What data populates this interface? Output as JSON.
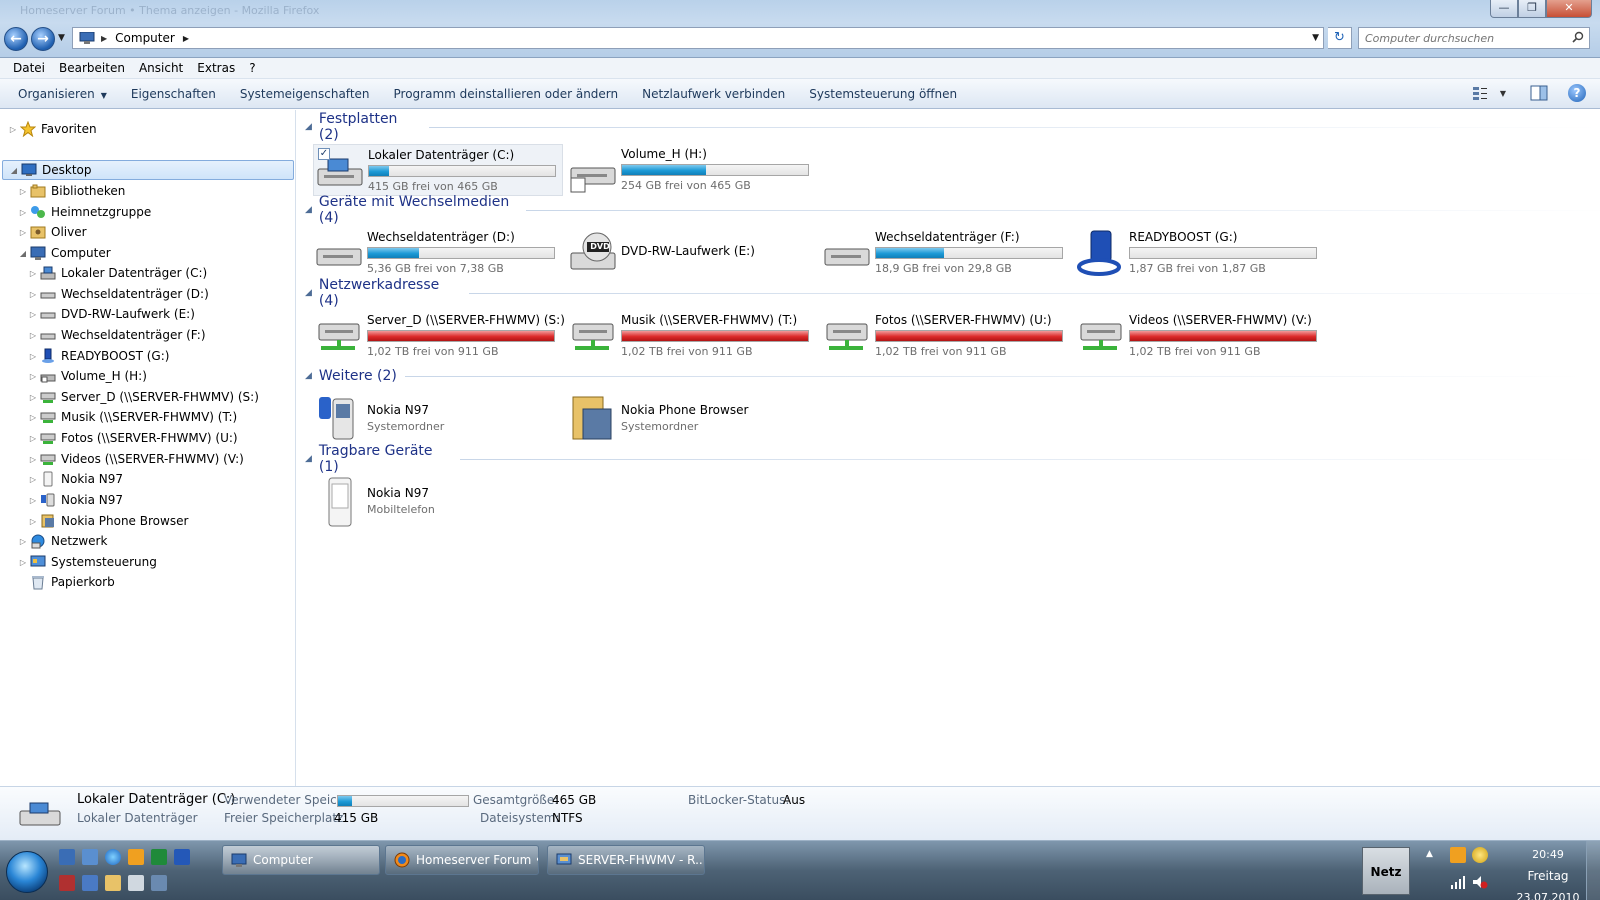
{
  "window": {
    "ghost_title": "Homeserver Forum • Thema anzeigen - Mozilla Firefox",
    "controls": {
      "minimize": "—",
      "maximize": "❐",
      "close": "✕"
    }
  },
  "address": {
    "crumb": "Computer",
    "search_placeholder": "Computer durchsuchen"
  },
  "menu": [
    "Datei",
    "Bearbeiten",
    "Ansicht",
    "Extras",
    "?"
  ],
  "commands": {
    "organize": "Organisieren",
    "properties": "Eigenschaften",
    "system_properties": "Systemeigenschaften",
    "uninstall": "Programm deinstallieren oder ändern",
    "map_drive": "Netzlaufwerk verbinden",
    "control_panel": "Systemsteuerung öffnen"
  },
  "tree": {
    "favorites": "Favoriten",
    "desktop": "Desktop",
    "libraries": "Bibliotheken",
    "homegroup": "Heimnetzgruppe",
    "user": "Oliver",
    "computer": "Computer",
    "drive_c": "Lokaler Datenträger (C:)",
    "drive_d": "Wechseldatenträger (D:)",
    "drive_e": "DVD-RW-Laufwerk (E:)",
    "drive_f": "Wechseldatenträger (F:)",
    "drive_g": "READYBOOST (G:)",
    "drive_h": "Volume_H (H:)",
    "drive_s": "Server_D (\\\\SERVER-FHWMV) (S:)",
    "drive_t": "Musik (\\\\SERVER-FHWMV) (T:)",
    "drive_u": "Fotos (\\\\SERVER-FHWMV) (U:)",
    "drive_v": "Videos (\\\\SERVER-FHWMV) (V:)",
    "nokia1": "Nokia N97",
    "nokia2": "Nokia N97",
    "nokia_browser": "Nokia Phone Browser",
    "network": "Netzwerk",
    "control_panel": "Systemsteuerung",
    "recycle": "Papierkorb"
  },
  "groups": {
    "hdd": "Festplatten (2)",
    "removable": "Geräte mit Wechselmedien (4)",
    "network": "Netzwerkadresse (4)",
    "other": "Weitere (2)",
    "portable": "Tragbare Geräte (1)"
  },
  "tiles": {
    "c": {
      "name": "Lokaler Datenträger (C:)",
      "free": "415 GB frei von 465 GB",
      "used_fraction": 0.108
    },
    "h": {
      "name": "Volume_H (H:)",
      "free": "254 GB frei von 465 GB",
      "used_fraction": 0.454
    },
    "d": {
      "name": "Wechseldatenträger (D:)",
      "free": "5,36 GB frei von 7,38 GB",
      "used_fraction": 0.274
    },
    "e": {
      "name": "DVD-RW-Laufwerk (E:)",
      "dvd_label": "DVD"
    },
    "f": {
      "name": "Wechseldatenträger (F:)",
      "free": "18,9 GB frei von 29,8 GB",
      "used_fraction": 0.366
    },
    "g": {
      "name": "READYBOOST (G:)",
      "free": "1,87 GB frei von 1,87 GB",
      "used_fraction": 0.0
    },
    "s": {
      "name": "Server_D (\\\\SERVER-FHWMV) (S:)",
      "free": "1,02 TB frei von 911 GB",
      "used_fraction": 1.0
    },
    "t": {
      "name": "Musik (\\\\SERVER-FHWMV) (T:)",
      "free": "1,02 TB frei von 911 GB",
      "used_fraction": 1.0
    },
    "u": {
      "name": "Fotos (\\\\SERVER-FHWMV) (U:)",
      "free": "1,02 TB frei von 911 GB",
      "used_fraction": 1.0
    },
    "v": {
      "name": "Videos (\\\\SERVER-FHWMV) (V:)",
      "free": "1,02 TB frei von 911 GB",
      "used_fraction": 1.0
    },
    "nokia": {
      "name": "Nokia N97",
      "sub": "Systemordner"
    },
    "nokia_browser": {
      "name": "Nokia Phone Browser",
      "sub": "Systemordner"
    },
    "nokia_phone": {
      "name": "Nokia N97",
      "sub": "Mobiltelefon"
    }
  },
  "details": {
    "name": "Lokaler Datenträger (C:)",
    "type": "Lokaler Datenträger",
    "used_label": "Verwendeter Speic...",
    "used_fraction": 0.108,
    "free_label": "Freier Speicherplatz:",
    "free_value": "415 GB",
    "total_label": "Gesamtgröße:",
    "total_value": "465 GB",
    "fs_label": "Dateisystem:",
    "fs_value": "NTFS",
    "bitlocker_label": "BitLocker-Status:",
    "bitlocker_value": "Aus"
  },
  "taskbar": {
    "buttons": [
      "Computer",
      "Homeserver Forum •...",
      "SERVER-FHWMV - R..."
    ],
    "netz": "Netz",
    "time": "20:49",
    "day": "Freitag",
    "date": "23.07.2010"
  },
  "colors": {
    "bar_blue": "#1c9ad6",
    "bar_red": "#dc2a2a",
    "group_title": "#1e3287"
  }
}
